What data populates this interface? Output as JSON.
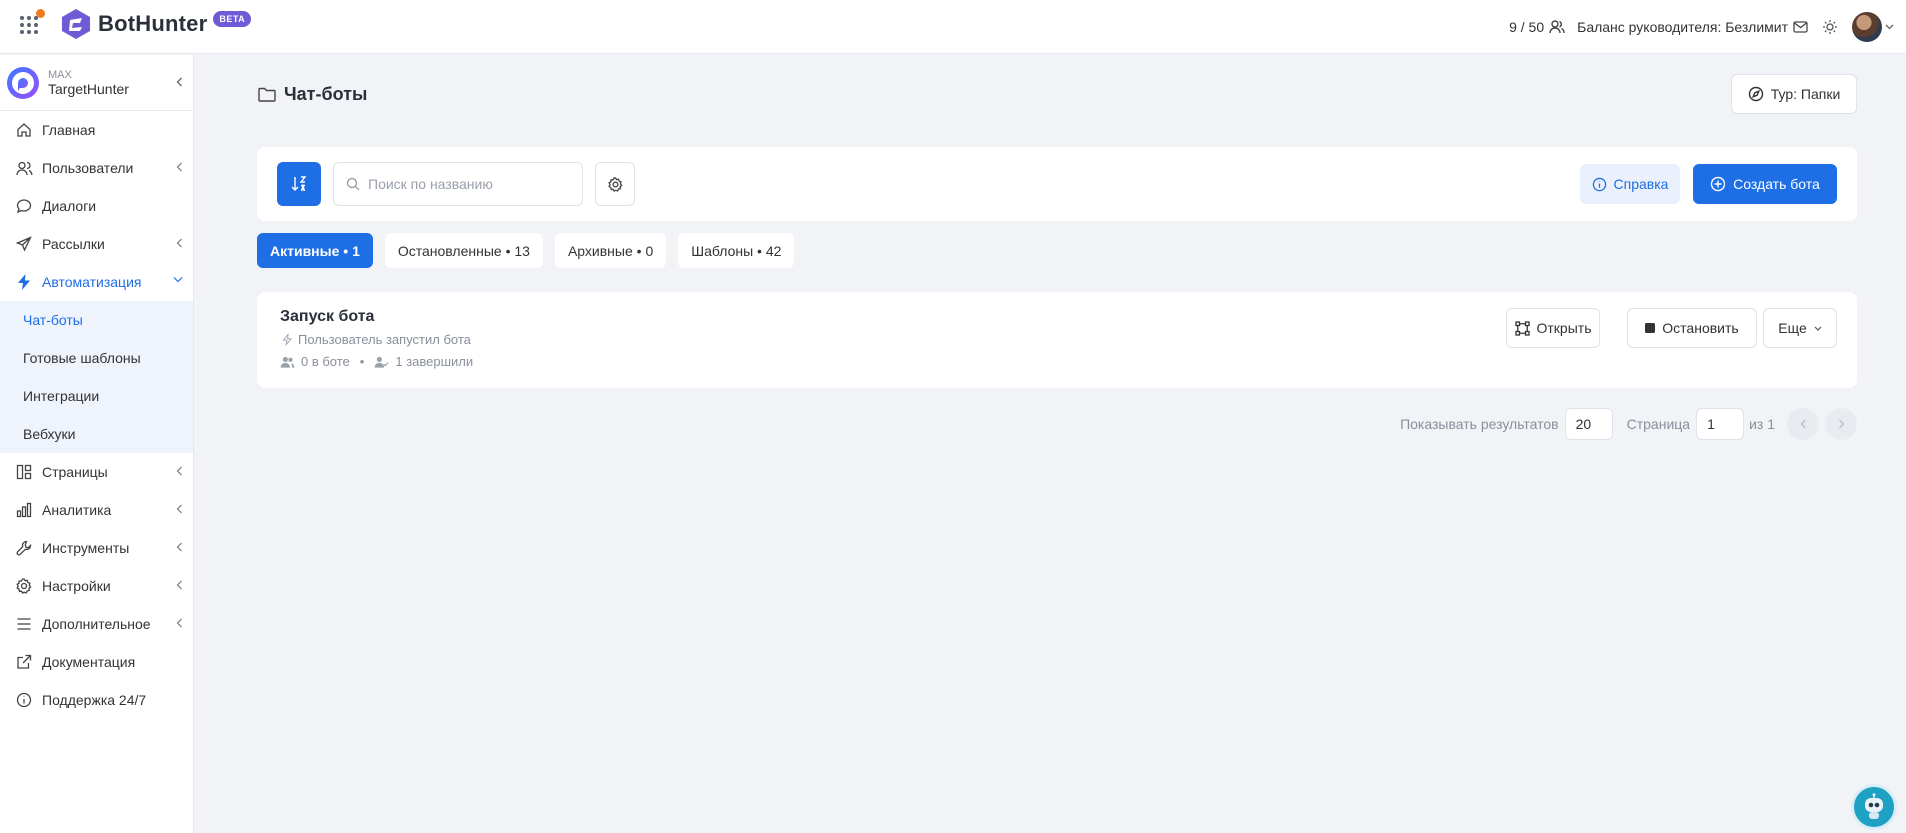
{
  "brand": {
    "name": "BotHunter",
    "badge": "BETA"
  },
  "header": {
    "quota": "9 / 50",
    "balance": "Баланс руководителя: Безлимит"
  },
  "account": {
    "platform": "MAX",
    "name": "TargetHunter"
  },
  "sidebar": {
    "items": [
      {
        "label": "Главная"
      },
      {
        "label": "Пользователи"
      },
      {
        "label": "Диалоги"
      },
      {
        "label": "Рассылки"
      },
      {
        "label": "Автоматизация"
      },
      {
        "label": "Страницы"
      },
      {
        "label": "Аналитика"
      },
      {
        "label": "Инструменты"
      },
      {
        "label": "Настройки"
      },
      {
        "label": "Дополнительное"
      },
      {
        "label": "Документация"
      },
      {
        "label": "Поддержка 24/7"
      }
    ],
    "submenu": [
      {
        "label": "Чат-боты"
      },
      {
        "label": "Готовые шаблоны"
      },
      {
        "label": "Интеграции"
      },
      {
        "label": "Вебхуки"
      }
    ]
  },
  "page": {
    "title": "Чат-боты",
    "tour_label": "Тур: Папки"
  },
  "toolbar": {
    "search_placeholder": "Поиск по названию",
    "help_label": "Справка",
    "create_label": "Создать бота"
  },
  "tabs": [
    {
      "label": "Активные • 1"
    },
    {
      "label": "Остановленные • 13"
    },
    {
      "label": "Архивные • 0"
    },
    {
      "label": "Шаблоны • 42"
    }
  ],
  "bot": {
    "name": "Запуск бота",
    "trigger": "Пользователь запустил бота",
    "in_bot": "0 в боте",
    "completed": "1 завершили",
    "open_label": "Открыть",
    "stop_label": "Остановить",
    "more_label": "Еще"
  },
  "pagination": {
    "show_label": "Показывать результатов",
    "per_page": "20",
    "page_label": "Страница",
    "page": "1",
    "of_label": "из 1"
  },
  "colors": {
    "accent": "#1e6ee6",
    "background": "#f2f3f7",
    "brand": "#6f5bd6",
    "notify": "#f07b1c"
  }
}
